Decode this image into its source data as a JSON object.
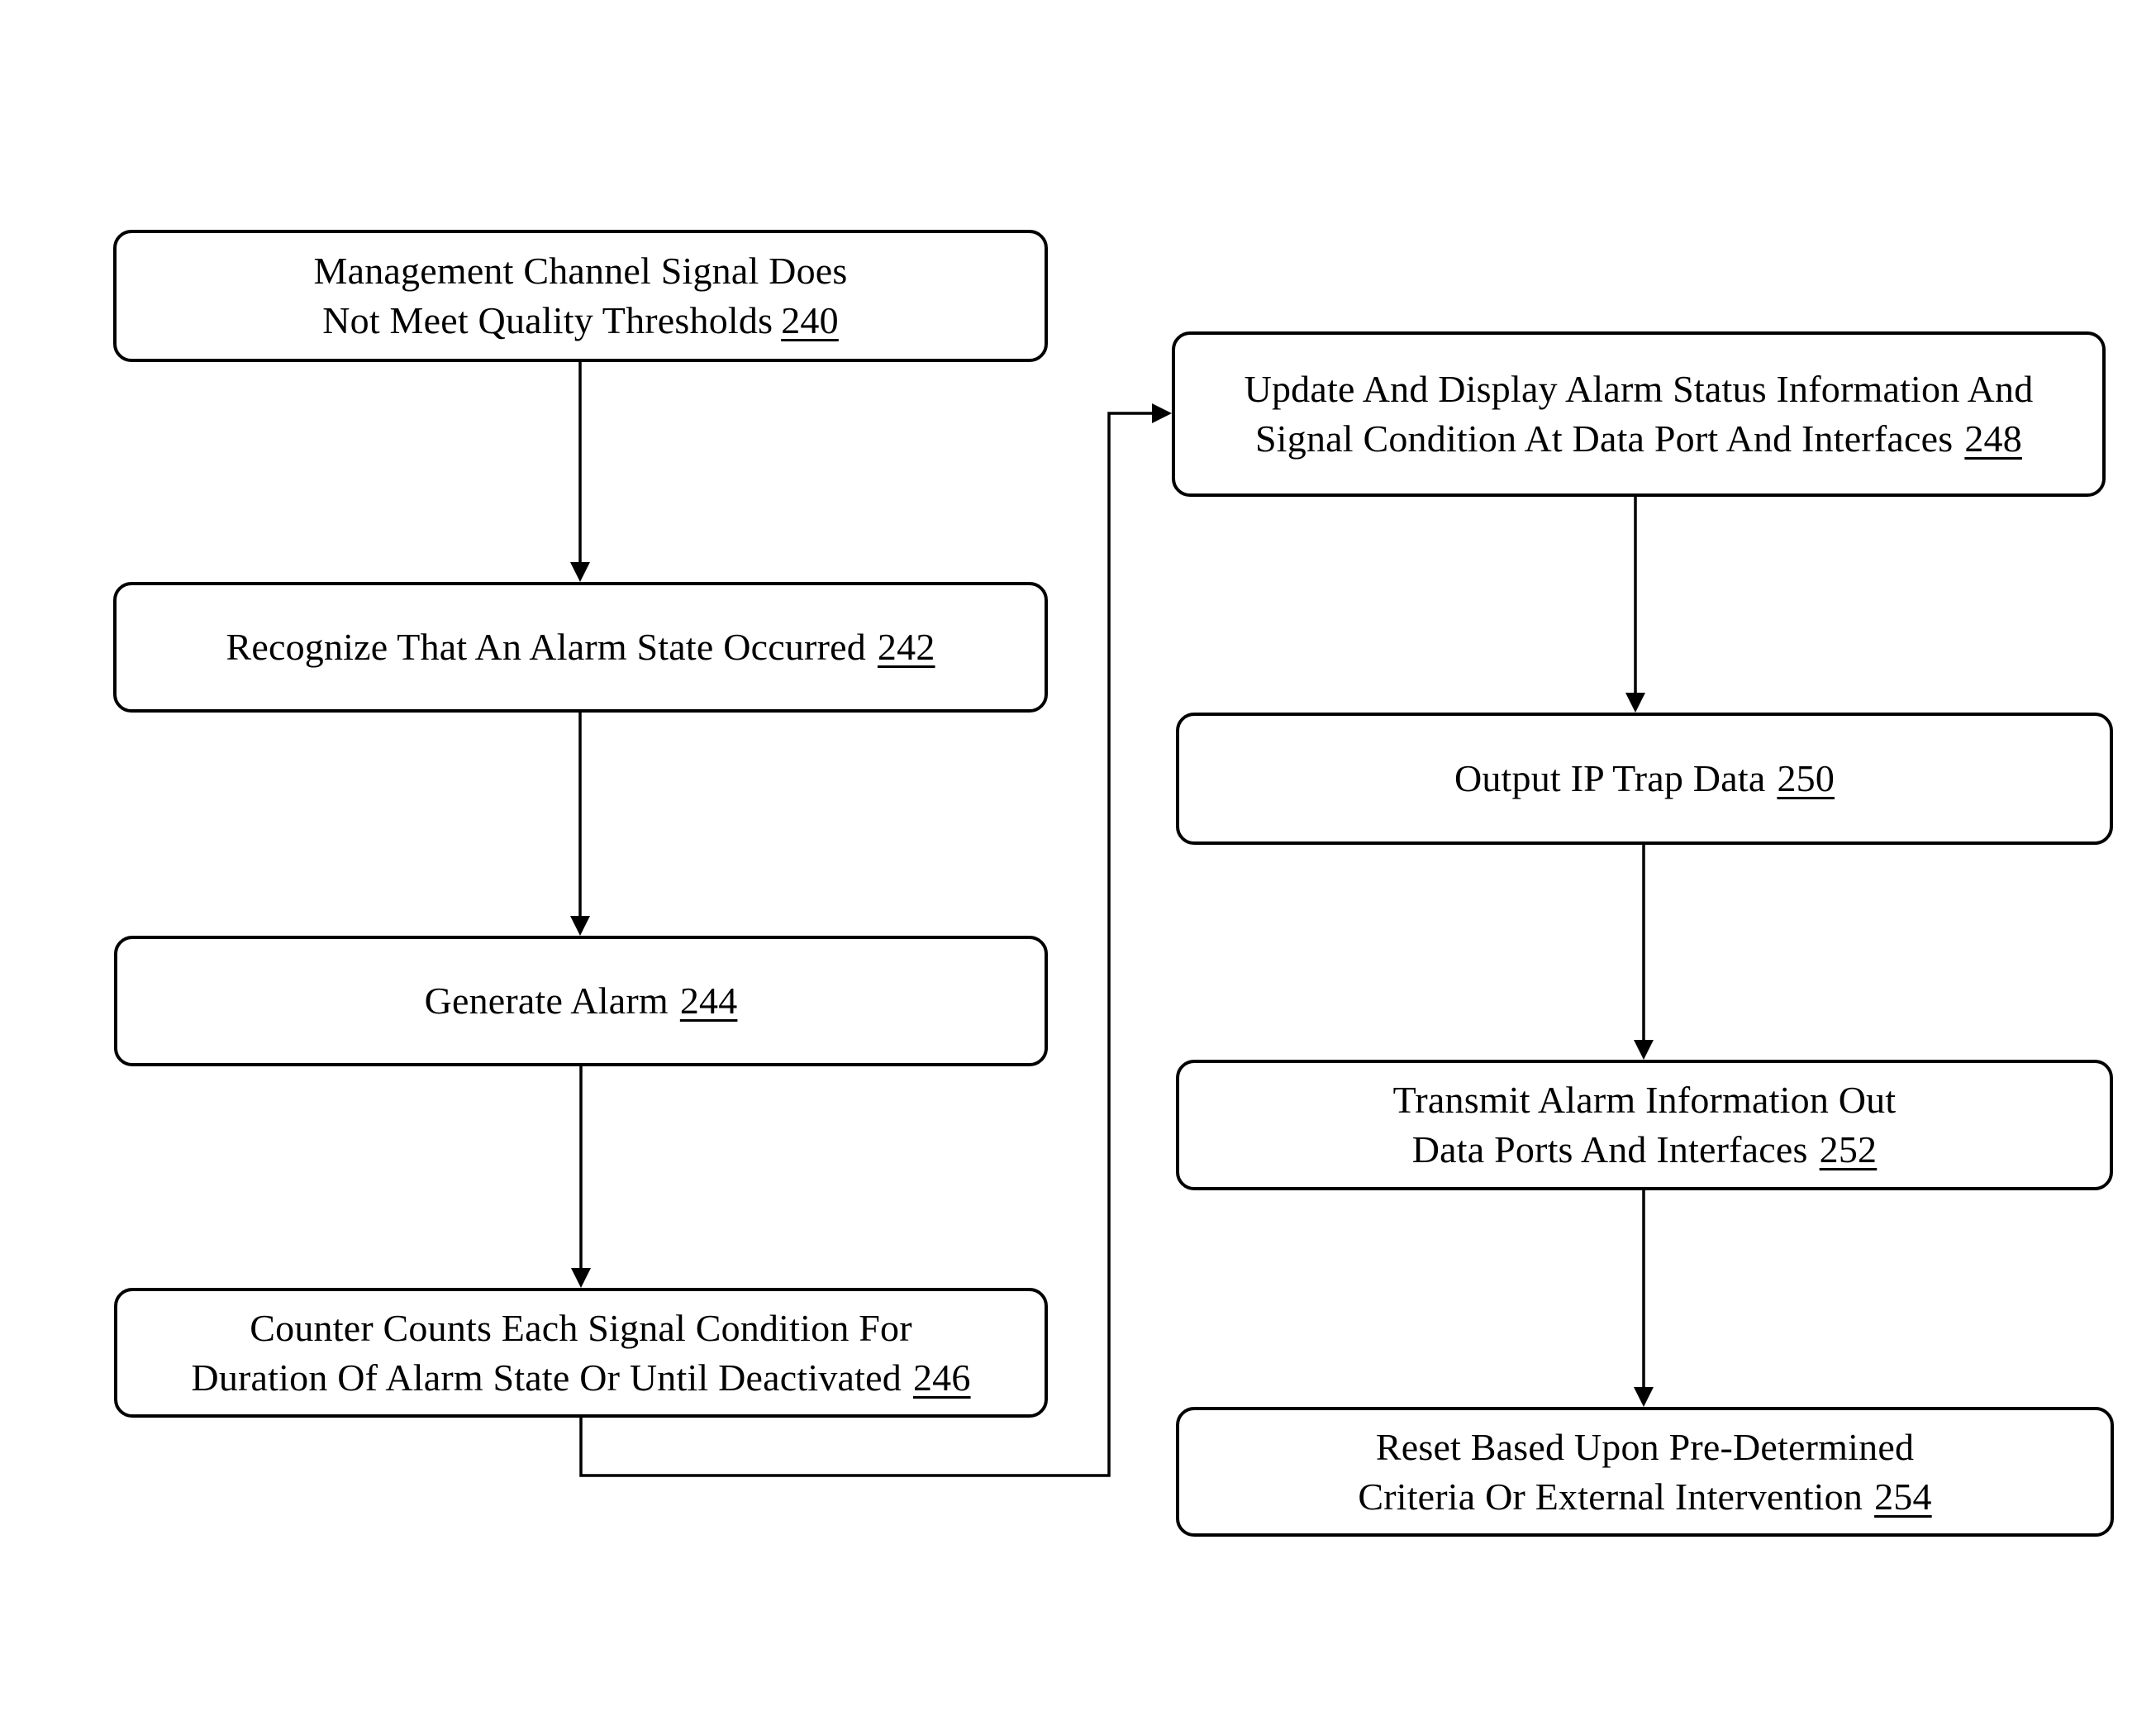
{
  "diagram": {
    "type": "flowchart",
    "steps": [
      {
        "id": "240",
        "lines": [
          "Management Channel Signal Does",
          "Not Meet Quality Thresholds"
        ],
        "ref": "240"
      },
      {
        "id": "242",
        "lines": [
          "Recognize That An Alarm State Occurred"
        ],
        "ref": "242"
      },
      {
        "id": "244",
        "lines": [
          "Generate Alarm"
        ],
        "ref": "244"
      },
      {
        "id": "246",
        "lines": [
          "Counter Counts Each Signal Condition For",
          "Duration Of Alarm State Or Until Deactivated"
        ],
        "ref": "246"
      },
      {
        "id": "248",
        "lines": [
          "Update And Display Alarm Status Information And",
          "Signal Condition At Data Port And Interfaces"
        ],
        "ref": "248"
      },
      {
        "id": "250",
        "lines": [
          "Output IP Trap Data"
        ],
        "ref": "250"
      },
      {
        "id": "252",
        "lines": [
          "Transmit Alarm Information Out",
          "Data Ports And Interfaces"
        ],
        "ref": "252"
      },
      {
        "id": "254",
        "lines": [
          "Reset Based Upon Pre-Determined",
          "Criteria Or External Intervention"
        ],
        "ref": "254"
      }
    ],
    "edges": [
      {
        "from": "240",
        "to": "242"
      },
      {
        "from": "242",
        "to": "244"
      },
      {
        "from": "244",
        "to": "246"
      },
      {
        "from": "246",
        "to": "248"
      },
      {
        "from": "248",
        "to": "250"
      },
      {
        "from": "250",
        "to": "252"
      },
      {
        "from": "252",
        "to": "254"
      }
    ]
  }
}
